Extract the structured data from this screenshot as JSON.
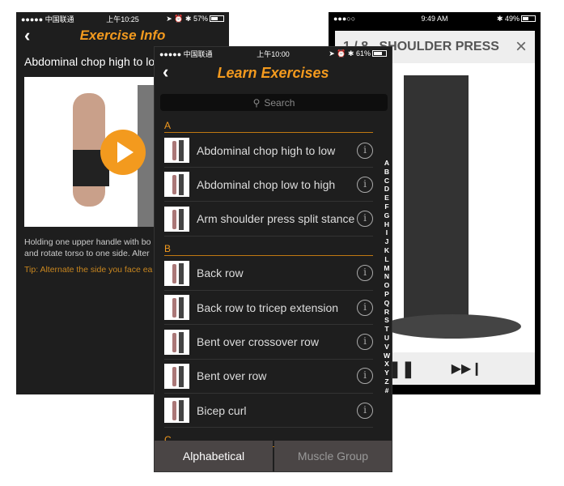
{
  "exercise_info": {
    "status": {
      "carrier": "●●●●● 中国联通",
      "time": "上午10:25",
      "battery": "57%"
    },
    "title": "Exercise Info",
    "exercise_name": "Abdominal chop high to low",
    "description_line1": "Holding one upper handle with bo",
    "description_line2": "and rotate torso to one side. Alter",
    "tip": "Tip: Alternate the side you face ea"
  },
  "workout": {
    "status": {
      "carrier": "●●●○○",
      "time": "9:49 AM",
      "battery": "49%"
    },
    "title": "1 / 8   SHOULDER PRESS",
    "close": "×"
  },
  "learn": {
    "status": {
      "carrier": "●●●●● 中国联通",
      "time": "上午10:00",
      "battery": "61%"
    },
    "title": "Learn Exercises",
    "search_placeholder": "Search",
    "sections": [
      {
        "letter": "A",
        "items": [
          "Abdominal chop high to low",
          "Abdominal chop low to high",
          "Arm shoulder press split stance"
        ]
      },
      {
        "letter": "B",
        "items": [
          "Back row",
          "Back row to tricep extension",
          "Bent over crossover row",
          "Bent over row",
          "Bicep curl"
        ]
      },
      {
        "letter": "C",
        "items": []
      }
    ],
    "index": [
      "A",
      "B",
      "C",
      "D",
      "E",
      "F",
      "G",
      "H",
      "I",
      "J",
      "K",
      "L",
      "M",
      "N",
      "O",
      "P",
      "Q",
      "R",
      "S",
      "T",
      "U",
      "V",
      "W",
      "X",
      "Y",
      "Z",
      "#"
    ],
    "tabs": [
      "Alphabetical",
      "Muscle Group"
    ]
  },
  "colors": {
    "accent": "#f39a1e",
    "background": "#1e1e1e"
  }
}
